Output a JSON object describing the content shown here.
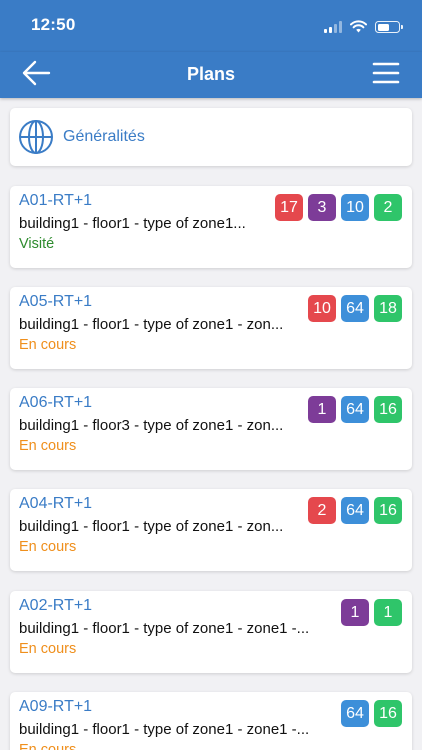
{
  "status_bar": {
    "time": "12:50"
  },
  "header": {
    "title": "Plans",
    "back_icon": "arrow-left-icon",
    "menu_icon": "hamburger-menu-icon"
  },
  "general": {
    "label": "Généralités",
    "icon": "globe-icon"
  },
  "colors": {
    "header": "#3a7cc6",
    "link": "#3a7cc6",
    "status_visited": "#2e8b2e",
    "status_in_progress": "#ef8f1c",
    "badge_red": "#e5484d",
    "badge_purple": "#7d3c98",
    "badge_blue": "#3d8fd9",
    "badge_green": "#2fc56a"
  },
  "plans": [
    {
      "name": "A01-RT+1",
      "description": "building1 - floor1 - type of zone1...",
      "status": "Visité",
      "status_type": "visited",
      "badges": [
        {
          "value": "17",
          "color": "red"
        },
        {
          "value": "3",
          "color": "purple"
        },
        {
          "value": "10",
          "color": "blue"
        },
        {
          "value": "2",
          "color": "green"
        }
      ]
    },
    {
      "name": "A05-RT+1",
      "description": "building1 - floor1 - type of zone1 - zon...",
      "status": "En cours",
      "status_type": "in_progress",
      "badges": [
        {
          "value": "10",
          "color": "red"
        },
        {
          "value": "64",
          "color": "blue"
        },
        {
          "value": "18",
          "color": "green"
        }
      ]
    },
    {
      "name": "A06-RT+1",
      "description": "building1 - floor3 - type of zone1 - zon...",
      "status": "En cours",
      "status_type": "in_progress",
      "badges": [
        {
          "value": "1",
          "color": "purple"
        },
        {
          "value": "64",
          "color": "blue"
        },
        {
          "value": "16",
          "color": "green"
        }
      ]
    },
    {
      "name": "A04-RT+1",
      "description": "building1 - floor1 - type of zone1 - zon...",
      "status": "En cours",
      "status_type": "in_progress",
      "badges": [
        {
          "value": "2",
          "color": "red"
        },
        {
          "value": "64",
          "color": "blue"
        },
        {
          "value": "16",
          "color": "green"
        }
      ]
    },
    {
      "name": "A02-RT+1",
      "description": "building1 - floor1 - type of zone1 - zone1 -...",
      "status": "En cours",
      "status_type": "in_progress",
      "badges": [
        {
          "value": "1",
          "color": "purple"
        },
        {
          "value": "1",
          "color": "green"
        }
      ]
    },
    {
      "name": "A09-RT+1",
      "description": "building1 - floor1 - type of zone1 - zone1 -...",
      "status": "En cours",
      "status_type": "in_progress",
      "badges": [
        {
          "value": "64",
          "color": "blue"
        },
        {
          "value": "16",
          "color": "green"
        }
      ]
    }
  ]
}
